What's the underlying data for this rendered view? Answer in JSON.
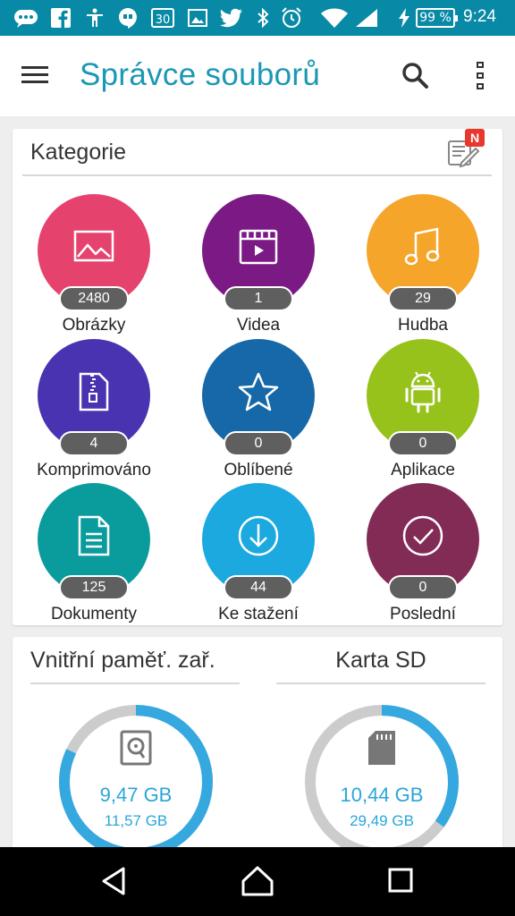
{
  "status_bar": {
    "battery": "99 %",
    "time": "9:24",
    "icons": [
      "messages-icon",
      "facebook-icon",
      "accessibility-icon",
      "hangouts-icon",
      "calendar-icon",
      "gallery-icon",
      "twitter-icon",
      "bluetooth-icon",
      "alarm-icon",
      "wifi-icon",
      "signal-icon",
      "charging-icon"
    ],
    "calendar_day": "30",
    "background": "#0889a5"
  },
  "app_bar": {
    "title": "Správce souborů",
    "title_color": "#1b98b4"
  },
  "categories": {
    "header": "Kategorie",
    "new_badge": "N",
    "items": [
      {
        "label": "Obrázky",
        "count": "2480",
        "color": "#e5436e",
        "icon": "image-icon"
      },
      {
        "label": "Videa",
        "count": "1",
        "color": "#7b1a85",
        "icon": "video-icon"
      },
      {
        "label": "Hudba",
        "count": "29",
        "color": "#f6a52b",
        "icon": "music-icon"
      },
      {
        "label": "Komprimováno",
        "count": "4",
        "color": "#4a33b0",
        "icon": "zip-icon"
      },
      {
        "label": "Oblíbené",
        "count": "0",
        "color": "#1668a8",
        "icon": "star-icon"
      },
      {
        "label": "Aplikace",
        "count": "0",
        "color": "#97c21c",
        "icon": "android-icon"
      },
      {
        "label": "Dokumenty",
        "count": "125",
        "color": "#0a9b9d",
        "icon": "document-icon"
      },
      {
        "label": "Ke stažení",
        "count": "44",
        "color": "#1ba9df",
        "icon": "download-icon"
      },
      {
        "label": "Poslední",
        "count": "0",
        "color": "#822c55",
        "icon": "recent-check-icon"
      }
    ]
  },
  "storage": {
    "internal": {
      "title": "Vnitřní paměť. zař.",
      "used": "9,47 GB",
      "total": "11,57 GB",
      "fraction_used": 0.82,
      "icon": "hard-drive-icon"
    },
    "sd": {
      "title": "Karta SD",
      "used": "10,44 GB",
      "total": "29,49 GB",
      "fraction_used": 0.35,
      "icon": "sd-card-icon"
    },
    "ring_color": "#35a8e0",
    "ring_track_color": "#cccccc"
  },
  "nav_bar": {
    "buttons": [
      "back-icon",
      "home-icon",
      "recents-icon"
    ]
  }
}
